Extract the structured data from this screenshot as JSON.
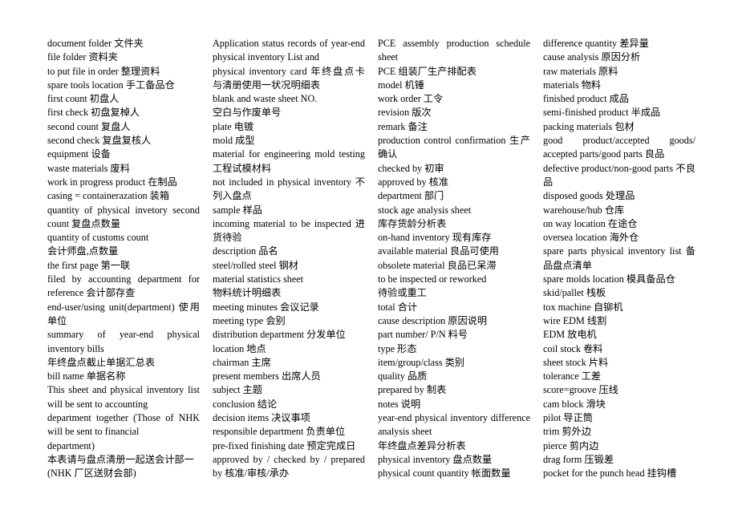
{
  "document": {
    "type": "bilingual-glossary",
    "title": "",
    "columns": [
      {
        "id": "column-1",
        "entries": [
          "document folder 文件夹",
          "file folder 资料夹",
          "to put file in order 整理资料",
          "spare tools location 手工备品仓",
          "first count 初盘人",
          "first check 初盘复棹人",
          "second count  复盘人",
          "second check 复盘复核人",
          "equipment 设备",
          "waste materials 废料",
          "work in progress product 在制品",
          "casing = containerazation 装箱",
          "quantity of physical invetory second count  复盘点数量",
          "quantity of customs count",
          "会计师盘,点数量",
          "the first page 第一联",
          "filed by accounting department for reference 会计部存查",
          "end-user/using unit(department) 使用单位",
          "summary of year-end physical inventory bills",
          "年终盘点截止单据汇总表",
          "bill name 单据名称",
          "This sheet and physical inventory list will be sent to accounting",
          "department together (Those of NHK will be sent to financial",
          "department)",
          "本表请与盘点清册一起送会计部一",
          "(NHK 厂区送财会部)"
        ]
      },
      {
        "id": "column-2",
        "entries": [
          "Application status records of year-end physical inventory List and",
          "physical inventory card 年终盘点卡与清册使用一状况明细表",
          "blank and waste sheet NO.",
          "空白与作废单号",
          "plate 电镀",
          "mold 成型",
          "material for engineering mold testing 工程试模材料",
          "not included in physical inventory 不列入盘点",
          "sample 样品",
          "incoming material to be inspected 进货待验",
          "description 品名",
          "steel/rolled steel 钢材",
          "material statistics sheet",
          "物料统计明细表",
          "meeting minutes 会议记录",
          "meeting type  会别",
          "distribution department 分发单位",
          "location 地点",
          "chairman 主席",
          "present members 出席人员",
          "subject 主题",
          "conclusion 结论",
          "decision items 决议事项",
          "responsible department 负责单位",
          "pre-fixed finishing date 预定完成日",
          "approved by / checked by / prepared by 核准/审核/承办"
        ]
      },
      {
        "id": "column-3",
        "entries": [
          "PCE assembly production schedule sheet",
          "PCE 组装厂生产排配表",
          "model 机锤",
          "work order 工令",
          "revision 版次",
          "remark 备注",
          "production control confirmation 生产确认",
          "checked by 初审",
          "approved by 核准",
          "department 部门",
          "stock age analysis sheet",
          "库存货龄分析表",
          "on-hand inventory 现有库存",
          "available material 良品可使用",
          "obsolete material 良品已呆滞",
          "to be inspected or reworked",
          "待验或重工",
          "total 合计",
          "cause description 原因说明",
          "part number/ P/N  料号",
          "type 形态",
          "item/group/class 类别",
          "quality 品质",
          "prepared by 制表",
          "notes 说明",
          "year-end physical inventory difference analysis sheet",
          "年终盘点差异分析表",
          "physical inventory 盘点数量",
          "physical count quantity 帐面数量"
        ]
      },
      {
        "id": "column-4",
        "entries": [
          "difference quantity 差异量",
          "cause analysis 原因分析",
          "raw materials 原料",
          "materials 物料",
          "finished product 成品",
          "semi-finished product 半成品",
          "packing materials 包材",
          "good product/accepted goods/ accepted parts/good parts 良品",
          "defective product/non-good parts 不良品",
          "disposed goods 处理品",
          "warehouse/hub 仓库",
          "on way location 在途仓",
          "oversea location 海外仓",
          "spare parts physical inventory list 备品盘点清单",
          "spare molds location 模具备品仓",
          "skid/pallet 栈板",
          "tox machine 自铆机",
          "wire EDM 线割",
          "EDM 放电机",
          "coil stock 卷料",
          "sheet stock 片料",
          "tolerance 工差",
          "score=groove 压线",
          "cam block 滑块",
          "pilot 导正筒",
          "trim 剪外边",
          "pierce 剪内边",
          "drag form 压锻差",
          "pocket for the punch head 挂钩槽"
        ]
      }
    ]
  }
}
